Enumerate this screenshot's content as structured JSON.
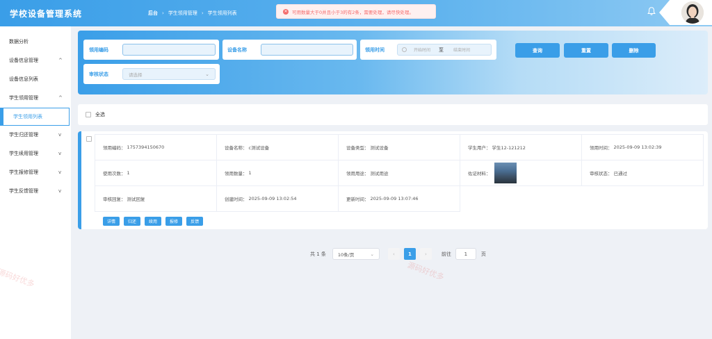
{
  "app": {
    "title": "学校设备管理系统"
  },
  "breadcrumb": [
    "后台",
    "学生领用管理",
    "学生领用列表"
  ],
  "toast": {
    "message": "可用数量大于0并且小于3的有2条，需要处理，请尽快处理。",
    "color": "#f56c6c"
  },
  "sidebar": {
    "items": [
      {
        "label": "数据分析"
      },
      {
        "label": "设备信息管理",
        "chevron": "^"
      },
      {
        "label": "设备信息列表"
      },
      {
        "label": "学生领用管理",
        "chevron": "^"
      },
      {
        "label": "学生领用列表"
      },
      {
        "label": "学生归还管理",
        "chevron": "v"
      },
      {
        "label": "学生续用管理",
        "chevron": "v"
      },
      {
        "label": "学生报修管理",
        "chevron": "v"
      },
      {
        "label": "学生反馈管理",
        "chevron": "v"
      }
    ]
  },
  "filters": {
    "code_label": "领用编码",
    "code_value": "",
    "device_label": "设备名称",
    "device_value": "",
    "time_label": "领用时间",
    "time_start_placeholder": "开始时间",
    "time_sep": "至",
    "time_end_placeholder": "结束时间",
    "status_label": "审核状态",
    "status_placeholder": "请选择",
    "buttons": {
      "search": "查询",
      "reset": "重置",
      "delete": "删除"
    }
  },
  "select_all": "全选",
  "record": {
    "fields": [
      [
        "领用编码：",
        "1757394150670"
      ],
      [
        "设备名称：",
        "c测试设备"
      ],
      [
        "设备类型：",
        "测试设备"
      ],
      [
        "学生用户：",
        "学生12-121212"
      ],
      [
        "领用时间：",
        "2025-09-09 13:02:39"
      ],
      [
        "使用次数：",
        "1"
      ],
      [
        "领用数量：",
        "1"
      ],
      [
        "领用用途：",
        "测试用途"
      ],
      [
        "佐证材料：",
        ""
      ],
      [
        "审核状态：",
        "已通过"
      ],
      [
        "审核回复：",
        "测试回复"
      ],
      [
        "创建时间：",
        "2025-09-09 13:02:54"
      ],
      [
        "更新时间：",
        "2025-09-09 13:07:46"
      ]
    ],
    "actions": [
      "详情",
      "归还",
      "续用",
      "报修",
      "反馈"
    ]
  },
  "pagination": {
    "total": "共 1 条",
    "page_size": "10条/页",
    "prev": "‹",
    "current": "1",
    "next": "›",
    "goto_label": "前往",
    "goto_value": "1",
    "goto_unit": "页"
  },
  "watermark": "源码好优多",
  "colors": {
    "primary": "#3a9ee8",
    "error": "#f56c6c"
  },
  "icons": {
    "bell": "bell-icon",
    "clock": "clock-icon",
    "error": "error-circle-icon"
  }
}
